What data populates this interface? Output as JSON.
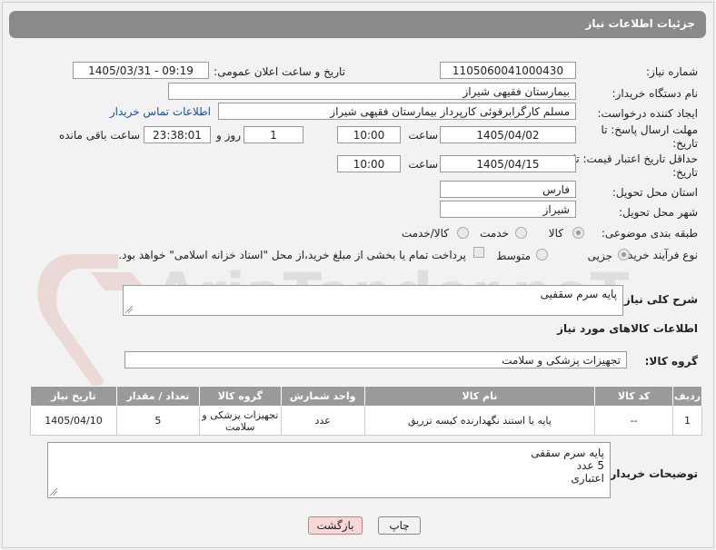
{
  "header": {
    "title": "جزئیات اطلاعات نیاز"
  },
  "form": {
    "need_number_label": "شماره نیاز:",
    "need_number": "1105060041000430",
    "announce_label": "تاریخ و ساعت اعلان عمومی:",
    "announce_value": "1405/03/31 - 09:19",
    "buyer_org_label": "نام دستگاه خریدار:",
    "buyer_org": "بیمارستان فقیهی شیراز",
    "creator_label": "ایجاد کننده درخواست:",
    "creator": "مسلم کارگرابرقوئی کارپرداز  بیمارستان فقیهی شیراز",
    "contact_link": "اطلاعات تماس خریدار",
    "reply_deadline_label": "مهلت ارسال پاسخ: تا تاریخ:",
    "reply_date": "1405/04/02",
    "time_label": "ساعت",
    "reply_time": "10:00",
    "days_value": "1",
    "days_label": "روز و",
    "remaining_value": "23:38:01",
    "remaining_label": "ساعت باقی مانده",
    "price_deadline_label": "حداقل تاریخ اعتبار قیمت: تا تاریخ:",
    "price_date": "1405/04/15",
    "price_time": "10:00",
    "province_label": "استان محل تحویل:",
    "province": "فارس",
    "city_label": "شهر محل تحویل:",
    "city": "شیراز",
    "category_label": "طبقه بندی موضوعی:",
    "category_options": [
      "کالا",
      "خدمت",
      "کالا/خدمت"
    ],
    "process_label": "نوع فرآیند خرید :",
    "process_options": [
      "جزیی",
      "متوسط"
    ],
    "payment_note": "پرداخت تمام یا بخشی از مبلغ خرید،از محل \"اسناد خزانه اسلامی\" خواهد بود.",
    "summary_label": "شرح کلی نیاز:",
    "summary": "پایه سرم سقفیی"
  },
  "goods": {
    "section_title": "اطلاعات کالاهای مورد نیاز",
    "group_label": "گروه کالا:",
    "group": "تجهیزات پزشکی و سلامت",
    "columns": [
      "ردیف",
      "کد کالا",
      "نام کالا",
      "واحد شمارش",
      "گروه کالا",
      "تعداد / مقدار",
      "تاریخ نیاز"
    ],
    "rows": [
      [
        "1",
        "--",
        "پایه یا استند نگهدارنده کیسه تزریق",
        "عدد",
        "تجهیزات پزشکی و سلامت",
        "5",
        "1405/04/10"
      ]
    ]
  },
  "notes": {
    "label": "توضیحات خریدار:",
    "lines": [
      "پایه سرم سقفی",
      "5 عدد",
      "اعتباری"
    ]
  },
  "buttons": {
    "print": "چاپ",
    "back": "بازگشت"
  },
  "watermark": "AriaTender.neT"
}
